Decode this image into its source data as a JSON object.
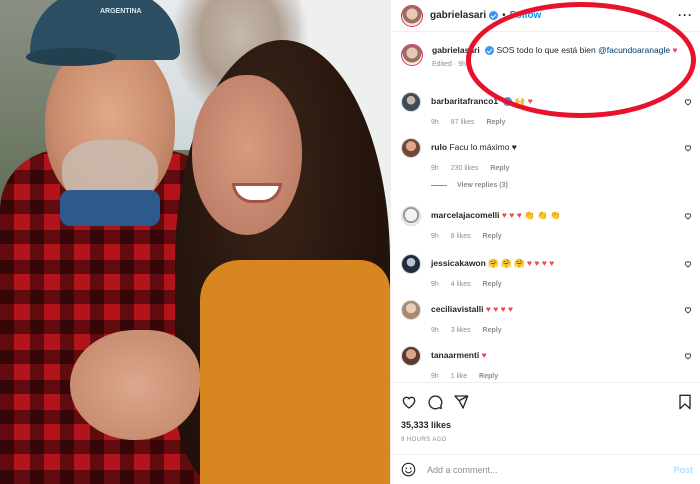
{
  "photo": {
    "cap_text": "ARGENTINA"
  },
  "header": {
    "username": "gabrielasari",
    "separator": "•",
    "follow_label": "Follow",
    "more_label": "···"
  },
  "caption": {
    "username": "gabrielasari",
    "text": "SOS todo lo que está bien",
    "mention": "@facundoaranagle",
    "heart": "♥",
    "edited": "Edited · 9h"
  },
  "comments": [
    {
      "username": "barbaritafranco1",
      "text": "🙌 ♥",
      "time": "9h",
      "likes": "87 likes",
      "reply": "Reply"
    },
    {
      "username": "rulo",
      "text": "Facu lo máximo ♥",
      "time": "9h",
      "likes": "230 likes",
      "reply": "Reply",
      "view_replies": "View replies (3)"
    },
    {
      "username": "marcelajacomelli",
      "text": "♥ ♥ ♥ 👏 👏 👏",
      "time": "9h",
      "likes": "8 likes",
      "reply": "Reply"
    },
    {
      "username": "jessicakawon",
      "text": "🤗 🤗 🤗 ♥ ♥ ♥ ♥",
      "time": "9h",
      "likes": "4 likes",
      "reply": "Reply"
    },
    {
      "username": "ceciliavistalli",
      "text": "♥ ♥ ♥ ♥",
      "time": "9h",
      "likes": "3 likes",
      "reply": "Reply"
    },
    {
      "username": "tanaarmenti",
      "text": "♥",
      "time": "9h",
      "likes": "1 like",
      "reply": "Reply"
    }
  ],
  "actions": {
    "likes_count": "35,333 likes",
    "time_ago": "9 HOURS AGO"
  },
  "add_comment": {
    "placeholder": "Add a comment...",
    "post_label": "Post"
  },
  "colors": {
    "accent": "#0095f6",
    "heart": "#ed4956",
    "annotation": "#e8132b"
  },
  "icons": [
    "heart-icon",
    "comment-icon",
    "share-icon",
    "bookmark-icon",
    "emoji-icon",
    "verified-badge-icon"
  ]
}
